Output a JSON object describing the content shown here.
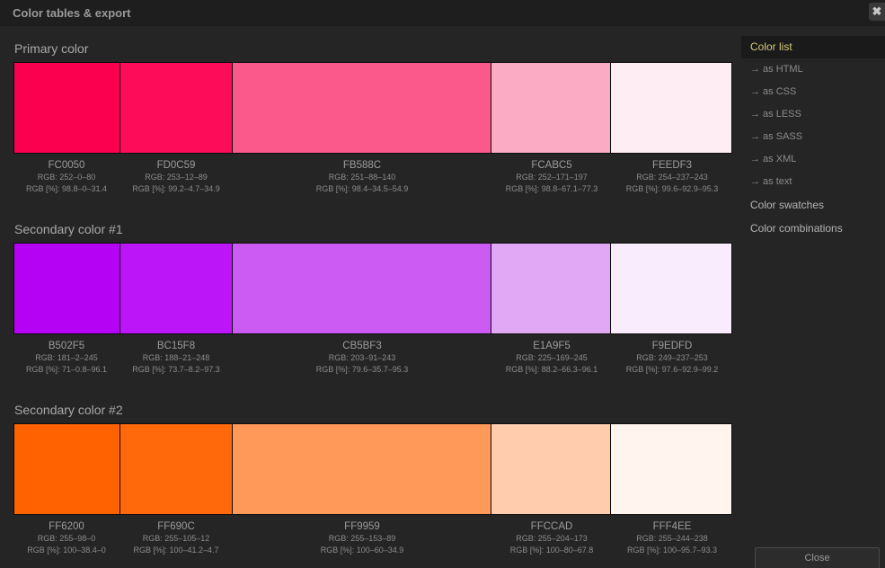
{
  "window": {
    "title": "Color tables & export",
    "close_glyph": "✖"
  },
  "sections": [
    {
      "title": "Primary color",
      "colors": [
        {
          "hex": "FC0050",
          "rgb": "RGB: 252–0–80",
          "pct": "RGB [%]: 98.8–0–31.4",
          "color": "#FC0050"
        },
        {
          "hex": "FD0C59",
          "rgb": "RGB: 253–12–89",
          "pct": "RGB [%]: 99.2–4.7–34.9",
          "color": "#FD0C59"
        },
        {
          "hex": "FB588C",
          "rgb": "RGB: 251–88–140",
          "pct": "RGB [%]: 98.4–34.5–54.9",
          "color": "#FB588C"
        },
        {
          "hex": "FCABC5",
          "rgb": "RGB: 252–171–197",
          "pct": "RGB [%]: 98.8–67.1–77.3",
          "color": "#FCABC5"
        },
        {
          "hex": "FEEDF3",
          "rgb": "RGB: 254–237–243",
          "pct": "RGB [%]: 99.6–92.9–95.3",
          "color": "#FEEDF3"
        }
      ]
    },
    {
      "title": "Secondary color #1",
      "colors": [
        {
          "hex": "B502F5",
          "rgb": "RGB: 181–2–245",
          "pct": "RGB [%]: 71–0.8–96.1",
          "color": "#B502F5"
        },
        {
          "hex": "BC15F8",
          "rgb": "RGB: 188–21–248",
          "pct": "RGB [%]: 73.7–8.2–97.3",
          "color": "#BC15F8"
        },
        {
          "hex": "CB5BF3",
          "rgb": "RGB: 203–91–243",
          "pct": "RGB [%]: 79.6–35.7–95.3",
          "color": "#CB5BF3"
        },
        {
          "hex": "E1A9F5",
          "rgb": "RGB: 225–169–245",
          "pct": "RGB [%]: 88.2–66.3–96.1",
          "color": "#E1A9F5"
        },
        {
          "hex": "F9EDFD",
          "rgb": "RGB: 249–237–253",
          "pct": "RGB [%]: 97.6–92.9–99.2",
          "color": "#F9EDFD"
        }
      ]
    },
    {
      "title": "Secondary color #2",
      "colors": [
        {
          "hex": "FF6200",
          "rgb": "RGB: 255–98–0",
          "pct": "RGB [%]: 100–38.4–0",
          "color": "#FF6200"
        },
        {
          "hex": "FF690C",
          "rgb": "RGB: 255–105–12",
          "pct": "RGB [%]: 100–41.2–4.7",
          "color": "#FF690C"
        },
        {
          "hex": "FF9959",
          "rgb": "RGB: 255–153–89",
          "pct": "RGB [%]: 100–60–34.9",
          "color": "#FF9959"
        },
        {
          "hex": "FFCCAD",
          "rgb": "RGB: 255–204–173",
          "pct": "RGB [%]: 100–80–67.8",
          "color": "#FFCCAD"
        },
        {
          "hex": "FFF4EE",
          "rgb": "RGB: 255–244–238",
          "pct": "RGB [%]: 100–95.7–93.3",
          "color": "#FFF4EE"
        }
      ]
    }
  ],
  "sidebar": {
    "color_list": "Color list",
    "export_items": [
      "→ as HTML",
      "→ as CSS",
      "→ as LESS",
      "→ as SASS",
      "→ as XML",
      "→ as text"
    ],
    "color_swatches": "Color swatches",
    "color_combinations": "Color combinations"
  },
  "footer": {
    "close_label": "Close"
  }
}
